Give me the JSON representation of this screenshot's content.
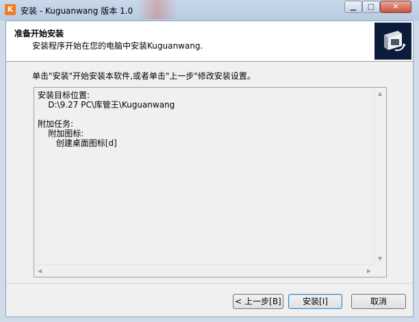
{
  "window": {
    "title": "安装 - Kuguanwang 版本 1.0",
    "app_icon_letter": "K",
    "controls": {
      "minimize": "▁",
      "maximize": "□",
      "close": "✕"
    }
  },
  "header": {
    "heading": "准备开始安装",
    "subheading": "安装程序开始在您的电脑中安装Kuguanwang."
  },
  "prompt": "单击\"安装\"开始安装本软件,或者单击\"上一步\"修改安装设置。",
  "summary_text": "安装目标位置:\n    D:\\9.27 PC\\库管王\\Kuguanwang\n\n附加任务:\n    附加图标:\n       创建桌面图标[d]",
  "buttons": {
    "back": "< 上一步[B]",
    "install": "安装[I]",
    "cancel": "取消"
  },
  "colors": {
    "accent_orange": "#f47a20",
    "logo_bg": "#0b1b3a",
    "close_red": "#c7523d"
  }
}
